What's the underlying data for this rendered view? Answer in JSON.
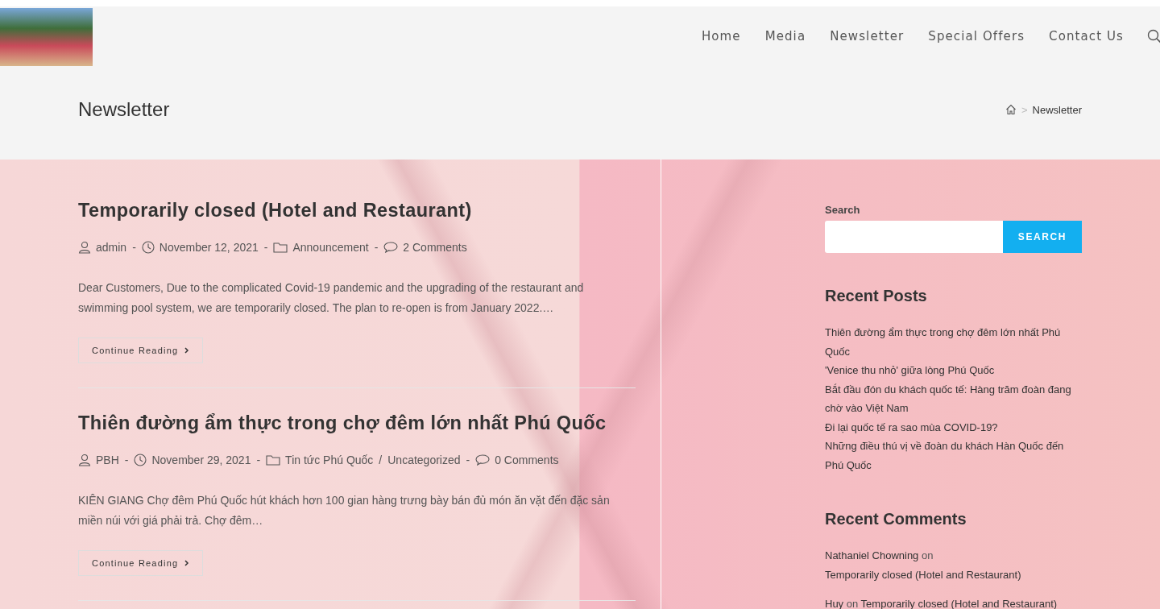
{
  "header": {
    "nav": [
      {
        "label": "Home",
        "selected": false
      },
      {
        "label": "Media",
        "selected": false
      },
      {
        "label": "Newsletter",
        "selected": false
      },
      {
        "label": "Special Offers",
        "selected": false
      },
      {
        "label": "Contact Us",
        "selected": false
      }
    ]
  },
  "page_title": "Newsletter",
  "breadcrumb": {
    "separator": ">",
    "current": "Newsletter"
  },
  "posts": [
    {
      "title": "Temporarily closed (Hotel and Restaurant)",
      "meta": [
        {
          "kind": "author",
          "text": "admin"
        },
        {
          "kind": "sep",
          "text": "-"
        },
        {
          "kind": "date",
          "text": "November 12, 2021"
        },
        {
          "kind": "sep",
          "text": "-"
        },
        {
          "kind": "category",
          "text": "Announcement"
        },
        {
          "kind": "sep",
          "text": "-"
        },
        {
          "kind": "comments",
          "text": "2 Comments"
        }
      ],
      "excerpt": "Dear Customers, Due to the complicated Covid-19 pandemic and the upgrading of the restaurant and swimming pool system, we are temporarily closed. The plan to re-open is from January 2022.…",
      "button": "Continue Reading"
    },
    {
      "title": "Thiên đường ẩm thực trong chợ đêm lớn nhất Phú Quốc",
      "meta": [
        {
          "kind": "author",
          "text": "PBH"
        },
        {
          "kind": "sep",
          "text": "-"
        },
        {
          "kind": "date",
          "text": "November 29, 2021"
        },
        {
          "kind": "sep",
          "text": "-"
        },
        {
          "kind": "category",
          "text": "Tin tức Phú Quốc"
        },
        {
          "kind": "slash",
          "text": "/"
        },
        {
          "kind": "category_more",
          "text": "Uncategorized"
        },
        {
          "kind": "sep",
          "text": "-"
        },
        {
          "kind": "comments",
          "text": "0 Comments"
        }
      ],
      "excerpt": "KIÊN GIANG Chợ đêm Phú Quốc hút khách hơn 100 gian hàng trưng bày bán đủ món ăn vặt đến đặc sản miền núi với giá phải trả. Chợ đêm…",
      "button": "Continue Reading"
    }
  ],
  "sidebar": {
    "search": {
      "label": "Search",
      "button": "SEARCH"
    },
    "recent_posts": {
      "title": "Recent Posts",
      "items": [
        "Thiên đường ẩm thực trong chợ đêm lớn nhất Phú Quốc",
        "'Venice thu nhỏ' giữa lòng Phú Quốc",
        "Bắt đầu đón du khách quốc tế: Hàng trăm đoàn đang chờ vào Việt Nam",
        "Đi lại quốc tế ra sao mùa COVID-19?",
        "Những điều thú vị về đoàn du khách Hàn Quốc đến Phú Quốc"
      ]
    },
    "recent_comments": {
      "title": "Recent Comments",
      "items": [
        {
          "author": "Nathaniel Chowning",
          "on": "on",
          "post": "Temporarily closed (Hotel and Restaurant)"
        },
        {
          "author": "Huy",
          "on": "on",
          "post": "Temporarily closed (Hotel and Restaurant)"
        }
      ]
    }
  }
}
